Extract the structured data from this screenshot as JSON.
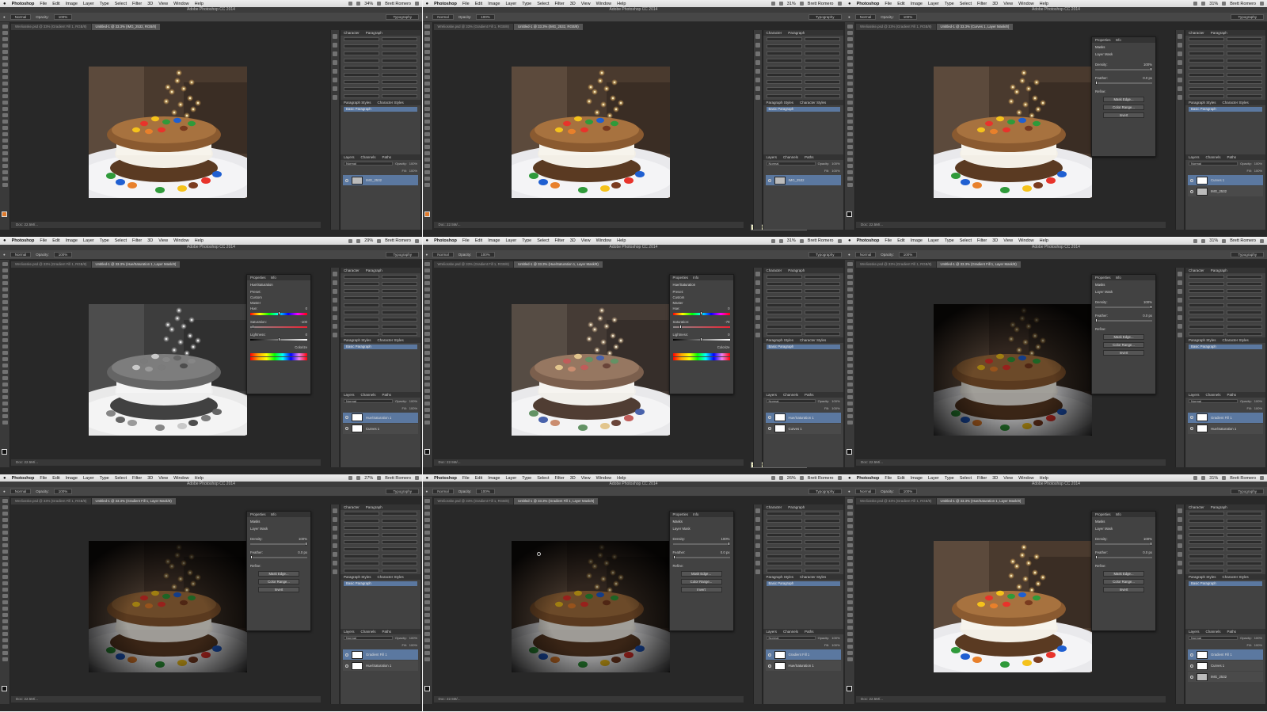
{
  "menubar": {
    "app_name": "Photoshop",
    "items": [
      "File",
      "Edit",
      "Image",
      "Layer",
      "Type",
      "Select",
      "Filter",
      "3D",
      "View",
      "Window",
      "Help"
    ],
    "user": "Brett Romero"
  },
  "window_title": "Adobe Photoshop CC 2014",
  "workspace": "Typography",
  "status_doc": "Doc: 22.5M/...",
  "tooltip_text": "Create new fill or adjustment layer",
  "panels": {
    "character_tab": "Character",
    "paragraph_tab": "Paragraph",
    "paragraph_styles_tab": "Paragraph Styles",
    "character_styles_tab": "Character Styles",
    "basic_paragraph": "Basic Paragraph",
    "layers_tab": "Layers",
    "channels_tab": "Channels",
    "paths_tab": "Paths",
    "properties_tab": "Properties",
    "info_tab": "Info",
    "blend_mode": "Normal",
    "opacity_label": "Opacity:",
    "opacity_value": "100%",
    "fill_label": "Fill:",
    "fill_value": "100%"
  },
  "props_labels": {
    "hue_sat_title": "Hue/Saturation",
    "preset_label": "Preset:",
    "preset_value": "Custom",
    "channel_value": "Master",
    "hue_label": "Hue:",
    "saturation_label": "Saturation:",
    "lightness_label": "Lightness:",
    "colorize_label": "Colorize",
    "masks_title": "Masks",
    "layer_mask_label": "Layer Mask",
    "density_label": "Density:",
    "density_value": "100%",
    "feather_label": "Feather:",
    "feather_value": "0.0 px",
    "refine_label": "Refine:",
    "mask_edge_button": "Mask Edge...",
    "color_range_button": "Color Range...",
    "invert_button": "Invert"
  },
  "frames": [
    {
      "zoom": "34%",
      "tab1": "Wreliosske.psd @ 33% (Gradient Fill 1, RGB/8)",
      "tab2": "Untitled-1 @ 33.3% (IMG_2532, RGB/8)",
      "photo": "color",
      "props": "none",
      "layers": [
        "IMG_2532"
      ],
      "tooltip": false,
      "fg_orange": true
    },
    {
      "zoom": "31%",
      "tab1": "Wreliosske.psd @ 33% (Gradient Fill 1, RGB/8)",
      "tab2": "Untitled-1 @ 33.3% (IMG_2532, RGB/8)",
      "photo": "color",
      "props": "none",
      "layers": [
        "IMG_2532"
      ],
      "tooltip": true,
      "fg_orange": true
    },
    {
      "zoom": "31%",
      "tab1": "Wreliosske.psd @ 33% (Gradient Fill 1, RGB/8)",
      "tab2": "Untitled-1 @ 33.3% (Curves 1, Layer Mask/8)",
      "photo": "color",
      "props": "masks",
      "layers": [
        "Curves 1",
        "IMG_2532"
      ],
      "tooltip": false,
      "fg_orange": false
    },
    {
      "zoom": "29%",
      "tab1": "Wreliosske.psd @ 33% (Gradient Fill 1, RGB/8)",
      "tab2": "Untitled-1 @ 33.3% (Hue/Saturation 1, Layer Mask/8)",
      "photo": "gray",
      "props": "huesat",
      "hue_value": "0",
      "sat_value": "-100",
      "light_value": "0",
      "sat_knob": 3,
      "layers": [
        "Hue/Saturation 1",
        "Curves 1"
      ],
      "tooltip": false,
      "fg_orange": false
    },
    {
      "zoom": "31%",
      "tab1": "Wreliosske.psd @ 33% (Gradient Fill 1, RGB/8)",
      "tab2": "Untitled-1 @ 33.3% (Hue/Saturation 1, Layer Mask/8)",
      "photo": "muted",
      "props": "huesat",
      "hue_value": "0",
      "sat_value": "-78",
      "light_value": "0",
      "sat_knob": 12,
      "layers": [
        "Hue/Saturation 1",
        "Curves 1"
      ],
      "tooltip": true,
      "fg_orange": false
    },
    {
      "zoom": "31%",
      "tab1": "Wreliosske.psd @ 33% (Gradient Fill 1, RGB/8)",
      "tab2": "Untitled-1 @ 33.3% (Gradient Fill 1, Layer Mask/8)",
      "photo": "dark",
      "props": "masks",
      "layers": [
        "Gradient Fill 1",
        "Hue/Saturation 1"
      ],
      "tooltip": false,
      "fg_orange": false
    },
    {
      "zoom": "27%",
      "tab1": "Wreliosske.psd @ 33% (Gradient Fill 1, RGB/8)",
      "tab2": "Untitled-1 @ 33.3% (Gradient Fill 1, Layer Mask/8)",
      "photo": "dark",
      "props": "masks",
      "layers": [
        "Gradient Fill 1",
        "Hue/Saturation 1"
      ],
      "tooltip": false,
      "fg_orange": false
    },
    {
      "zoom": "26%",
      "tab1": "Wreliosske.psd @ 33% (Gradient Fill 1, RGB/8)",
      "tab2": "Untitled-1 @ 33.3% (Gradient Fill 1, Layer Mask/8)",
      "photo": "dark",
      "props": "masks",
      "layers": [
        "Gradient Fill 1",
        "Hue/Saturation 1"
      ],
      "tooltip": false,
      "fg_orange": false,
      "cursor": true
    },
    {
      "zoom": "31%",
      "tab1": "Wreliosske.psd @ 33% (Gradient Fill 1, RGB/8)",
      "tab2": "Untitled-1 @ 33.3% (Hue/Saturation 1, Layer Mask/8)",
      "photo": "color",
      "props": "masks",
      "layers": [
        "Gradient Fill 1",
        "Curves 1",
        "IMG_2532"
      ],
      "tooltip": false,
      "fg_orange": false
    }
  ]
}
